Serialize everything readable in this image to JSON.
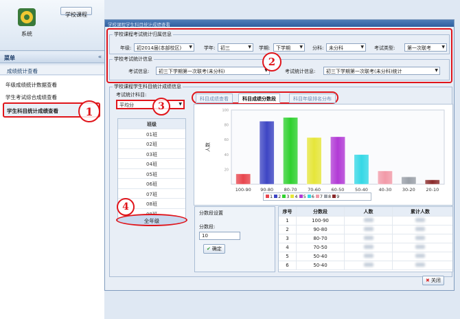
{
  "toolbar": {
    "system_label": "系统",
    "school_label": "学校课程"
  },
  "menu": {
    "title": "菜单",
    "collapse": "«",
    "group": "成绩统计查看",
    "items": [
      "年级成绩统计数据查看",
      "学生考试综合成绩查看",
      "学生科目统计成绩查看"
    ]
  },
  "window": {
    "title": "学校课程学生科目统计成绩查看"
  },
  "filter": {
    "legend": "学校课程考试统计归属信息",
    "grade_label": "年级:",
    "grade_value": "初2014届(本部校区)",
    "year_label": "学年:",
    "year_value": "初三",
    "term_label": "学期:",
    "term_value": "下学期",
    "branch_label": "分科:",
    "branch_value": "未分科",
    "type_label": "考试类型:",
    "type_value": "第一次联考"
  },
  "exam": {
    "legend": "学校考试统计信息",
    "info_label": "考试信息:",
    "info_value": "初三下学期第一次联考(未分科)",
    "stat_label": "考试统计信息:",
    "stat_value": "初三下学期第一次联考(未分科)统计"
  },
  "panel": {
    "legend": "学校课程学生科目统计成绩信息",
    "subject_label": "考试统计科目:",
    "subject_value": "平均分",
    "class_header": "班级",
    "classes": [
      "01班",
      "02班",
      "03班",
      "04班",
      "05班",
      "06班",
      "07班",
      "08班",
      "09班"
    ],
    "all_grade": "全年级"
  },
  "tabs": [
    "科目成绩查看",
    "科目成绩分数段",
    "科目年级排名分布"
  ],
  "markers": [
    "1",
    "2",
    "3",
    "4"
  ],
  "chart_data": {
    "type": "bar",
    "ylabel": "人数",
    "categories": [
      "100-90",
      "90-80",
      "80-70",
      "70-60",
      "60-50",
      "50-40",
      "40-30",
      "30-20",
      "20-10"
    ],
    "values": [
      14,
      85,
      90,
      63,
      64,
      40,
      18,
      10,
      6
    ],
    "ylim": [
      0,
      100
    ],
    "yticks": [
      "100",
      "80",
      "60",
      "40",
      "20"
    ],
    "colors": [
      "#e8464e",
      "#3e46c4",
      "#2fd12f",
      "#e6e63a",
      "#b23ad6",
      "#35d8e6",
      "#f29aa8",
      "#9aa0a8",
      "#8a2a2a"
    ],
    "legend": [
      "1",
      "2",
      "3",
      "4",
      "5",
      "6",
      "7",
      "8",
      "9"
    ]
  },
  "setting": {
    "legend": "分数段设置",
    "label": "分数段:",
    "value": "10",
    "ok": "确定"
  },
  "table": {
    "headers": [
      "序号",
      "分数段",
      "人数",
      "累计人数"
    ],
    "rows": [
      [
        "1",
        "100-90"
      ],
      [
        "2",
        "90-80"
      ],
      [
        "3",
        "80-70"
      ],
      [
        "4",
        "70-50"
      ],
      [
        "5",
        "50-40"
      ],
      [
        "6",
        "50-40"
      ]
    ]
  },
  "close": "关闭"
}
